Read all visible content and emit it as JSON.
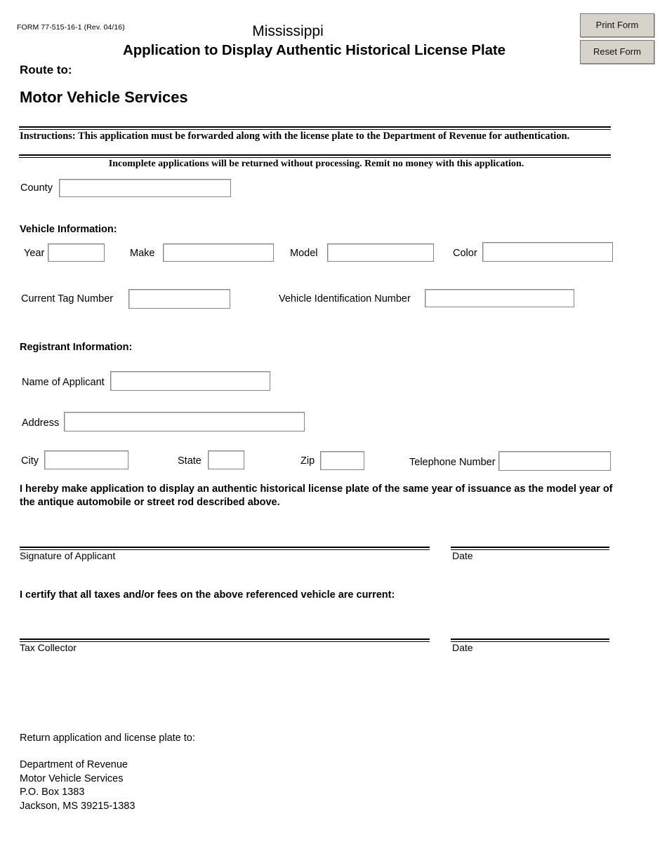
{
  "header": {
    "form_number": "FORM  77-515-16-1 (Rev. 04/16)",
    "state": "Mississippi",
    "title": "Application to Display Authentic Historical License Plate"
  },
  "buttons": {
    "print": "Print Form",
    "reset": "Reset Form",
    "background_color": "#d6d3cb",
    "border_color": "#7a786f"
  },
  "route": {
    "label": "Route to:",
    "destination": "Motor Vehicle Services"
  },
  "instructions": {
    "main": "Instructions: This application must be forwarded along with the license plate to the Department of Revenue for authentication.",
    "note": "Incomplete applications will be returned without processing. Remit no money with this application."
  },
  "county": {
    "label": "County",
    "value": "",
    "placeholder": ""
  },
  "vehicle": {
    "heading": "Vehicle Information:",
    "year": {
      "label": "Year",
      "value": "",
      "placeholder": ""
    },
    "make": {
      "label": "Make",
      "value": "",
      "placeholder": ""
    },
    "model": {
      "label": "Model",
      "value": "",
      "placeholder": ""
    },
    "color": {
      "label": "Color",
      "value": "",
      "placeholder": ""
    },
    "current_tag": {
      "label": "Current Tag Number",
      "value": "",
      "placeholder": ""
    },
    "vin": {
      "label": "Vehicle Identification Number",
      "value": "",
      "placeholder": ""
    }
  },
  "registrant": {
    "heading": "Registrant Information:",
    "name": {
      "label": "Name of Applicant",
      "value": "",
      "placeholder": ""
    },
    "address": {
      "label": "Address",
      "value": "",
      "placeholder": ""
    },
    "city": {
      "label": "City",
      "value": "",
      "placeholder": ""
    },
    "state": {
      "label": "State",
      "value": "",
      "placeholder": ""
    },
    "zip": {
      "label": "Zip",
      "value": "",
      "placeholder": ""
    },
    "telephone": {
      "label": "Telephone Number",
      "value": "",
      "placeholder": ""
    }
  },
  "declaration": {
    "hereby": "I hereby make application to display an authentic historical license plate of the same year of issuance as the model year of the antique automobile or street rod described above.",
    "certify": "I certify that all taxes and/or fees on the above referenced vehicle are current:"
  },
  "signatures": {
    "applicant_label": "Signature of Applicant",
    "applicant_date_label": "Date",
    "collector_label": "Tax Collector",
    "collector_date_label": "Date"
  },
  "return_block": {
    "heading": "Return application and license plate to:",
    "address": "Department of Revenue\nMotor Vehicle Services\nP.O. Box 1383\nJackson, MS 39215-1383"
  }
}
